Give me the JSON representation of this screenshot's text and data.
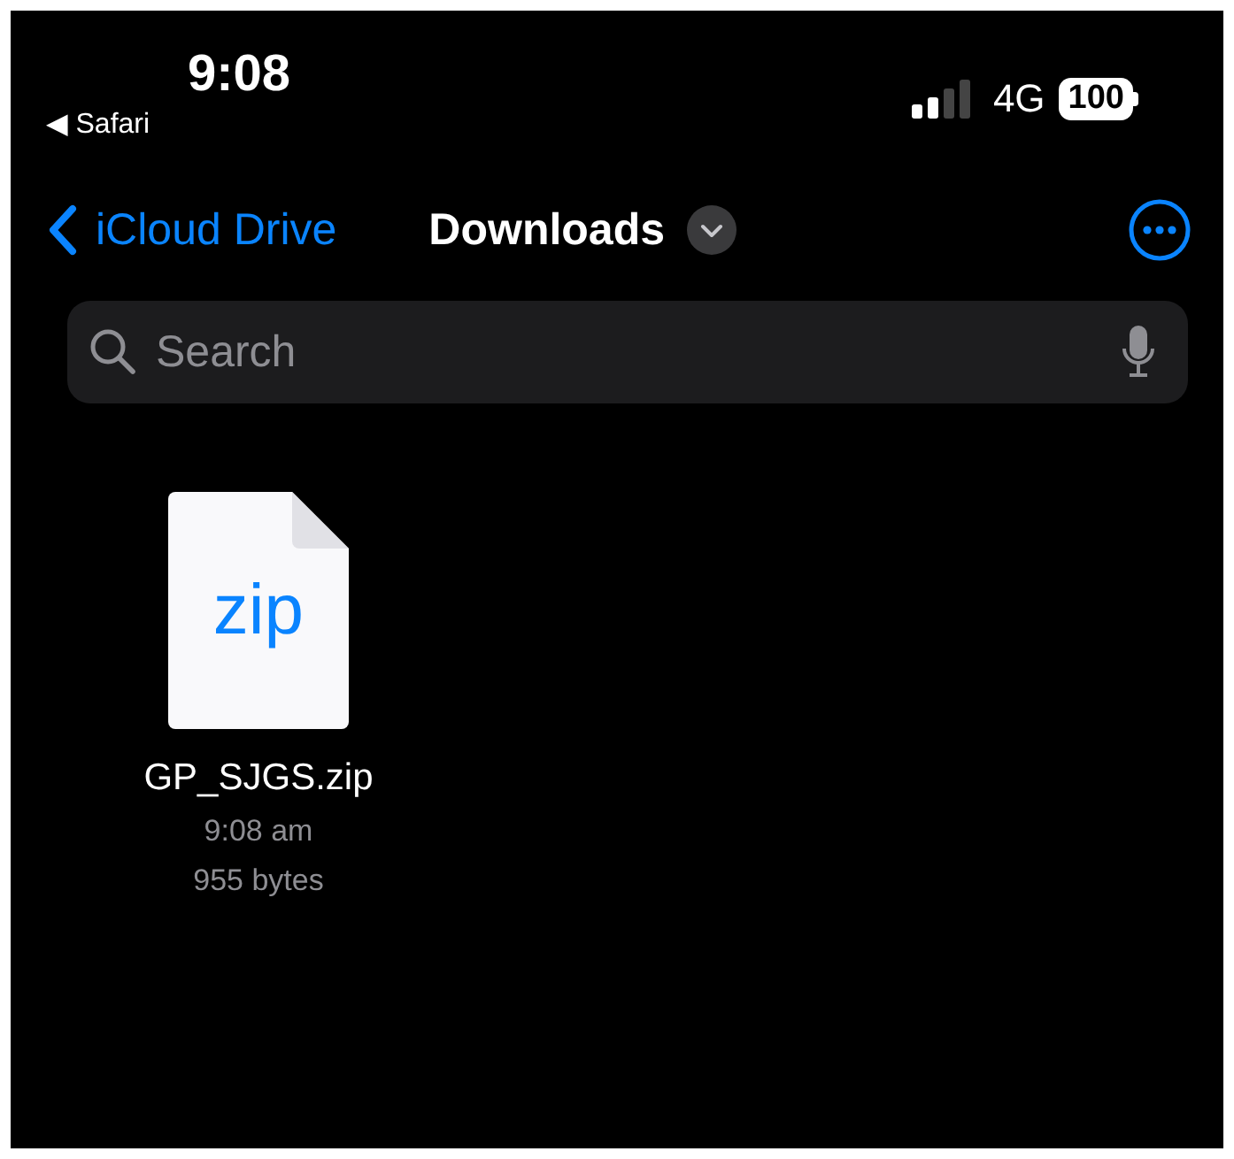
{
  "status_bar": {
    "time": "9:08",
    "back_app": "◀ Safari",
    "network": "4G",
    "battery": "100"
  },
  "nav": {
    "back_label": "iCloud Drive",
    "title": "Downloads"
  },
  "search": {
    "placeholder": "Search"
  },
  "files": [
    {
      "kind": "zip",
      "extension": "zip",
      "name": "GP_SJGS.zip",
      "time": "9:08 am",
      "size": "955 bytes"
    }
  ]
}
